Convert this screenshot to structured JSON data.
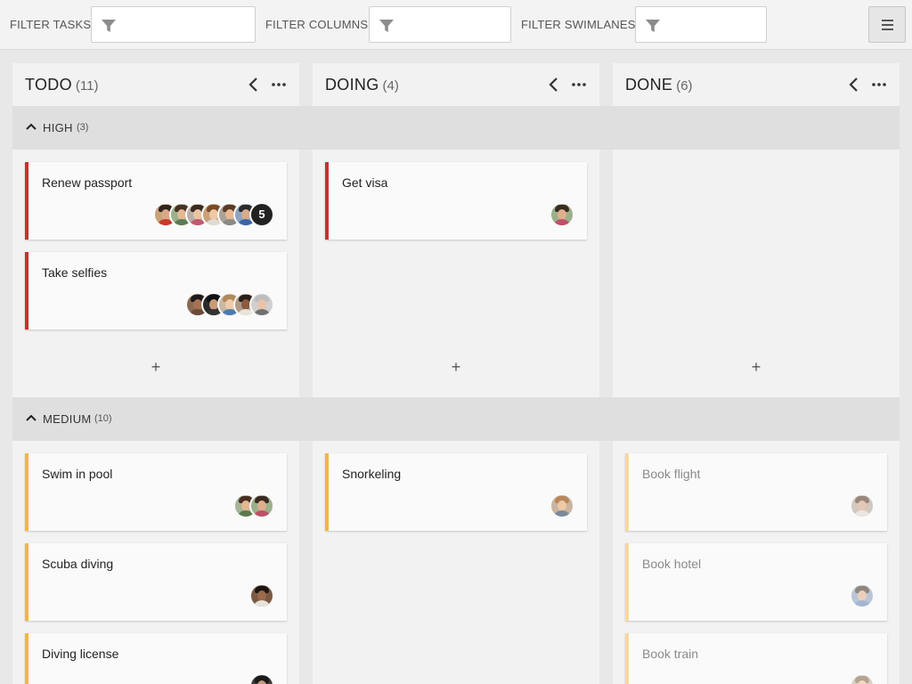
{
  "toolbar": {
    "filter_tasks_label": "FILTER TASKS",
    "filter_columns_label": "FILTER COLUMNS",
    "filter_swimlanes_label": "FILTER SWIMLANES",
    "filter_tasks_value": "",
    "filter_columns_value": "",
    "filter_swimlanes_value": "",
    "menu_icon": "hamburger-icon"
  },
  "columns": [
    {
      "title": "TODO",
      "count": "(11)"
    },
    {
      "title": "DOING",
      "count": "(4)"
    },
    {
      "title": "DONE",
      "count": "(6)"
    }
  ],
  "swimlanes": [
    {
      "name": "HIGH",
      "count": "(3)"
    },
    {
      "name": "MEDIUM",
      "count": "(10)"
    }
  ],
  "cards": {
    "high_todo": [
      {
        "title": "Renew passport",
        "extra_assignees": "5"
      },
      {
        "title": "Take selfies"
      }
    ],
    "high_doing": [
      {
        "title": "Get visa"
      }
    ],
    "medium_todo": [
      {
        "title": "Swim in pool"
      },
      {
        "title": "Scuba diving"
      },
      {
        "title": "Diving license"
      }
    ],
    "medium_doing": [
      {
        "title": "Snorkeling"
      }
    ],
    "medium_done": [
      {
        "title": "Book flight"
      },
      {
        "title": "Book hotel"
      },
      {
        "title": "Book train"
      }
    ]
  },
  "add_label": "+",
  "colors": {
    "priority_high": "#cc2f2f",
    "priority_medium": "#f4b63d",
    "priority_done": "#f8d89a"
  }
}
